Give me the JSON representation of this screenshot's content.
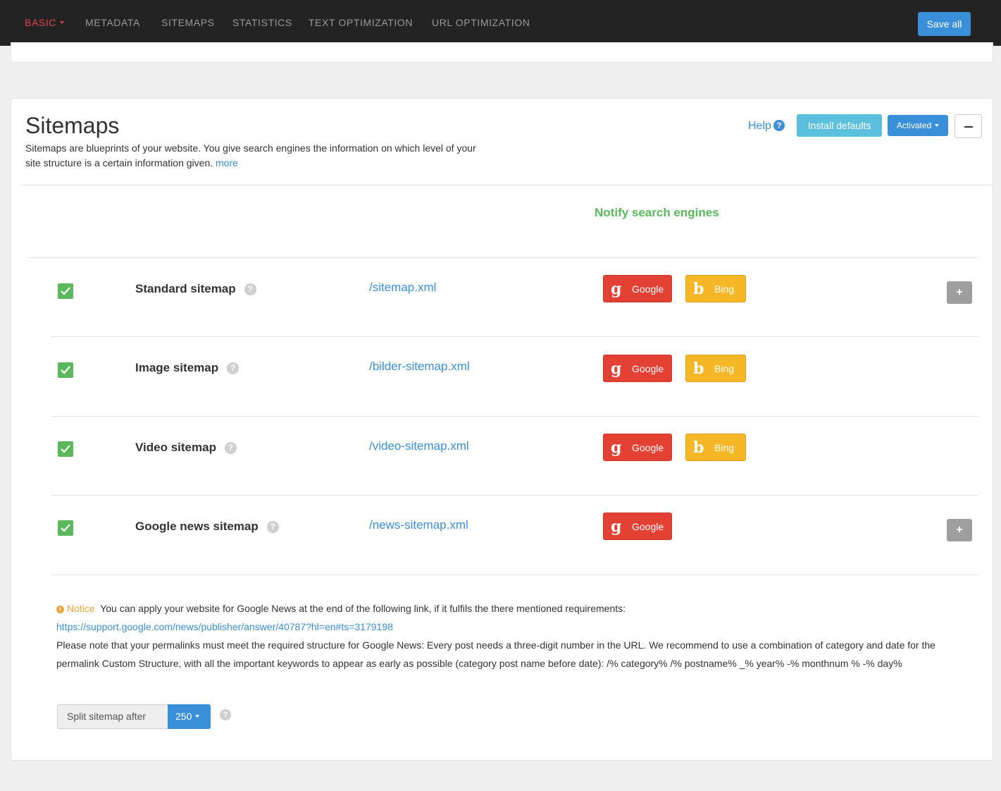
{
  "nav": {
    "items": [
      {
        "label": "BASIC"
      },
      {
        "label": "METADATA"
      },
      {
        "label": "SITEMAPS"
      },
      {
        "label": "STATISTICS"
      },
      {
        "label": "TEXT OPTIMIZATION"
      },
      {
        "label": "URL OPTIMIZATION"
      }
    ],
    "active": "BASIC",
    "save_label": "Save all"
  },
  "section": {
    "title": "Sitemaps",
    "description": "Sitemaps are blueprints of your website. You give search engines the information on which level of your site structure is a certain information given.",
    "more_label": "more",
    "help_label": "Help",
    "install_label": "Install defaults",
    "status_label": "Activated",
    "notify_header": "Notify search engines"
  },
  "sitemaps": [
    {
      "name": "Standard sitemap",
      "path": "/sitemap.xml",
      "checked": true,
      "engines": [
        "Google",
        "Bing"
      ],
      "expandable": true
    },
    {
      "name": "Image sitemap",
      "path": "/bilder-sitemap.xml",
      "checked": true,
      "engines": [
        "Google",
        "Bing"
      ],
      "expandable": false
    },
    {
      "name": "Video sitemap",
      "path": "/video-sitemap.xml",
      "checked": true,
      "engines": [
        "Google",
        "Bing"
      ],
      "expandable": false
    },
    {
      "name": "Google news sitemap",
      "path": "/news-sitemap.xml",
      "checked": true,
      "engines": [
        "Google"
      ],
      "expandable": true
    }
  ],
  "engines": {
    "google": "Google",
    "bing": "Bing"
  },
  "notice": {
    "tag": "Notice",
    "text": "You can apply your website for Google News at the end of the following link, if it fulfils the there mentioned requirements:",
    "link": "https://support.google.com/news/publisher/answer/40787?hl=en#ts=3179198",
    "note": "Please note that your permalinks must meet the required structure for Google News: Every post needs a three-digit number in the URL. We recommend to use a combination of category and date for the permalink Custom Structure, with all the important keywords to appear as early as possible (category post name before date): /% category% /% postname% _% year% -% monthnum % -% day%"
  },
  "split": {
    "label": "Split sitemap after",
    "value": "250"
  },
  "colors": {
    "topbar": "#232323",
    "active_nav": "#e5414e",
    "primary": "#3a8fd9",
    "info": "#5bc0de",
    "success": "#5cb85c",
    "google": "#e34133",
    "bing": "#f5b726",
    "warning": "#f0a23c"
  }
}
